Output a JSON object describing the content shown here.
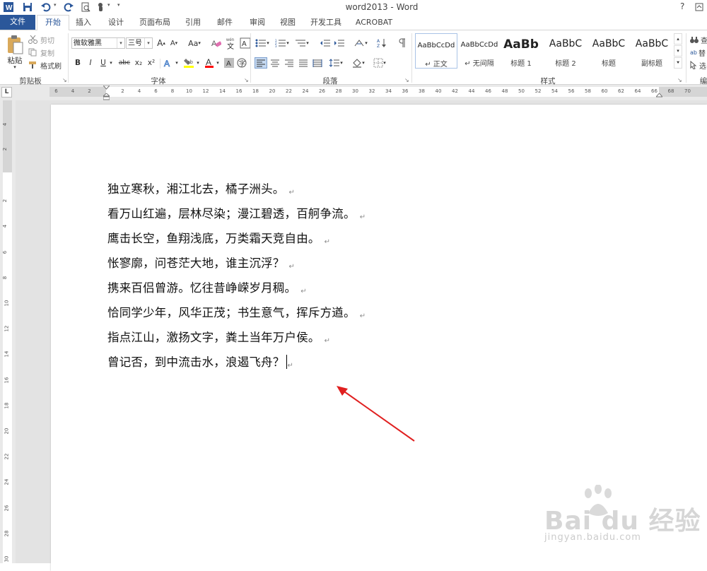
{
  "window": {
    "title": "word2013 - Word",
    "help_label": "?"
  },
  "tabs": [
    {
      "id": "file",
      "label": "文件"
    },
    {
      "id": "home",
      "label": "开始"
    },
    {
      "id": "insert",
      "label": "插入"
    },
    {
      "id": "design",
      "label": "设计"
    },
    {
      "id": "layout",
      "label": "页面布局"
    },
    {
      "id": "references",
      "label": "引用"
    },
    {
      "id": "mailings",
      "label": "邮件"
    },
    {
      "id": "review",
      "label": "审阅"
    },
    {
      "id": "view",
      "label": "视图"
    },
    {
      "id": "developer",
      "label": "开发工具"
    },
    {
      "id": "acrobat",
      "label": "ACROBAT"
    }
  ],
  "clipboard": {
    "paste_label": "粘贴",
    "cut_label": "剪切",
    "copy_label": "复制",
    "painter_label": "格式刷",
    "group_label": "剪贴板"
  },
  "font": {
    "font_name": "微软雅黑",
    "font_size": "三号",
    "grow_label": "A",
    "shrink_label": "A",
    "case_label": "Aa",
    "bold_label": "B",
    "italic_label": "I",
    "underline_label": "U",
    "strike_label": "abc",
    "sub_label": "x₂",
    "sup_label": "x²",
    "group_label": "字体"
  },
  "paragraph": {
    "group_label": "段落"
  },
  "styles": {
    "group_label": "样式",
    "items": [
      {
        "sample": "AaBbCcDd",
        "name": "↵ 正文"
      },
      {
        "sample": "AaBbCcDd",
        "name": "↵ 无间隔"
      },
      {
        "sample": "AaBb",
        "name": "标题 1"
      },
      {
        "sample": "AaBbC",
        "name": "标题 2"
      },
      {
        "sample": "AaBbC",
        "name": "标题"
      },
      {
        "sample": "AaBbC",
        "name": "副标题"
      }
    ]
  },
  "editing": {
    "find_label": "查",
    "replace_label": "替",
    "select_label": "选",
    "group_label": "编"
  },
  "ruler": {
    "h_left_numbers": [
      "6",
      "4",
      "2"
    ],
    "h_numbers": [
      "2",
      "4",
      "6",
      "8",
      "10",
      "12",
      "14",
      "16",
      "18",
      "20",
      "22",
      "24",
      "26",
      "28",
      "30",
      "32",
      "34",
      "36",
      "38",
      "40",
      "42",
      "44",
      "46",
      "48",
      "50",
      "52",
      "54",
      "56",
      "58",
      "60",
      "62",
      "64",
      "66",
      "68",
      "70"
    ],
    "v_numbers": [
      "4",
      "2",
      "2",
      "4",
      "6",
      "8",
      "10",
      "12",
      "14",
      "16",
      "18",
      "20",
      "22",
      "24",
      "26",
      "28",
      "30"
    ],
    "corner_label": "L"
  },
  "document": {
    "lines": [
      "独立寒秋，湘江北去，橘子洲头。",
      "看万山红遍，层林尽染；漫江碧透，百舸争流。",
      "鹰击长空，鱼翔浅底，万类霜天竞自由。",
      "怅寥廓，问苍茫大地，谁主沉浮？",
      "携来百侣曾游。忆往昔峥嵘岁月稠。",
      "恰同学少年，风华正茂；书生意气，挥斥方遒。",
      "指点江山，激扬文字，粪土当年万户侯。",
      "曾记否，到中流击水，浪遏飞舟？"
    ],
    "paragraph_mark": "↵"
  },
  "watermark": {
    "text": "Bai du 经验",
    "url": "jingyan.baidu.com"
  },
  "colors": {
    "accent": "#2b579a",
    "highlight": "#ffff00",
    "font_color": "#ff0000",
    "arrow": "#e02020"
  }
}
